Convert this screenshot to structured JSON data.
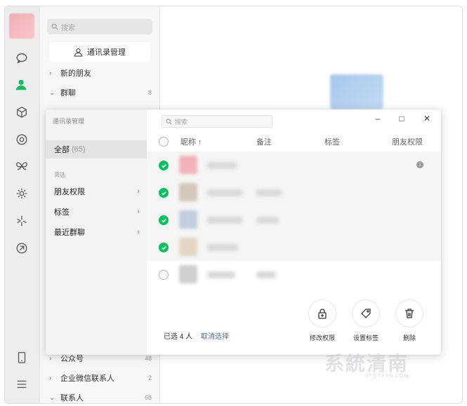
{
  "sidebar": {
    "icons": [
      "chat-icon",
      "contacts-icon",
      "box-icon",
      "moments-icon",
      "butterfly-icon",
      "settings-cog-icon",
      "sparkle-icon",
      "link-icon",
      "phone-icon",
      "menu-icon"
    ]
  },
  "contacts": {
    "search_placeholder": "搜索",
    "manage_button": "通讯录管理",
    "rows_top": [
      {
        "label": "新的朋友",
        "count": "",
        "expanded": false
      },
      {
        "label": "群聊",
        "count": "8",
        "expanded": true
      }
    ],
    "rows_bottom": [
      {
        "label": "公众号",
        "count": "48",
        "expanded": false
      },
      {
        "label": "企业微信联系人",
        "count": "2",
        "expanded": false
      },
      {
        "label": "联系人",
        "count": "68",
        "expanded": true
      }
    ]
  },
  "modal": {
    "title": "通讯录管理",
    "all_label": "全部",
    "all_count": "(65)",
    "filter_header": "筛选",
    "filters": [
      "朋友权限",
      "标签",
      "最近群聊"
    ],
    "search_placeholder": "搜索",
    "window_controls": {
      "minimize": "–",
      "maximize": "□",
      "close": "✕"
    },
    "columns": {
      "nickname": "昵称 ↑",
      "remark": "备注",
      "tag": "标签",
      "permission": "朋友权限"
    },
    "rows": [
      {
        "checked": true,
        "avatar_color": "#f2b3b8"
      },
      {
        "checked": true,
        "avatar_color": "#d4c6b8"
      },
      {
        "checked": true,
        "avatar_color": "#c3cde0"
      },
      {
        "checked": true,
        "avatar_color": "#e3d7c4"
      },
      {
        "checked": false,
        "avatar_color": "#cfcfcf"
      }
    ],
    "footer": {
      "selected_text": "已选 4 人",
      "cancel_text": "取消选择"
    },
    "actions": [
      {
        "label": "修改权限",
        "icon": "lock-icon"
      },
      {
        "label": "设置标签",
        "icon": "tag-icon"
      },
      {
        "label": "删除",
        "icon": "trash-icon"
      }
    ]
  },
  "watermark": {
    "main": "系統清南",
    "sub": "XTQTXXN.COM"
  },
  "colors": {
    "accent_green": "#07c160",
    "link_blue": "#576b95"
  }
}
